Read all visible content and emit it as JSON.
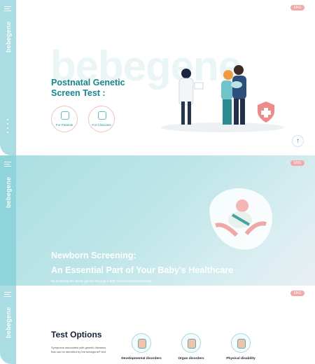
{
  "brand": "bebegene",
  "lang_label": "ENG",
  "hero": {
    "watermark": "bebegene",
    "title": "Postnatal Genetic Screen Test :",
    "buttons": [
      "For Patients",
      "For Clinicians"
    ],
    "scroll_up": "↑"
  },
  "newborn": {
    "title_line1": "Newborn Screening:",
    "title_line2": "An Essential Part of Your Baby's Healthcare",
    "text": "By analyzing the whole genetic through a SNP chromosomal microarray."
  },
  "options": {
    "title": "Test Options",
    "text": "Symptoms associated with genetic diseases that can be identified by the bebegeneP test",
    "items": [
      "Developmental disorders",
      "Organ disorders",
      "Physical disability"
    ]
  },
  "colors": {
    "primary": "#14878f",
    "sidebar": "#a9dde3",
    "accent": "#f4a9a7"
  }
}
